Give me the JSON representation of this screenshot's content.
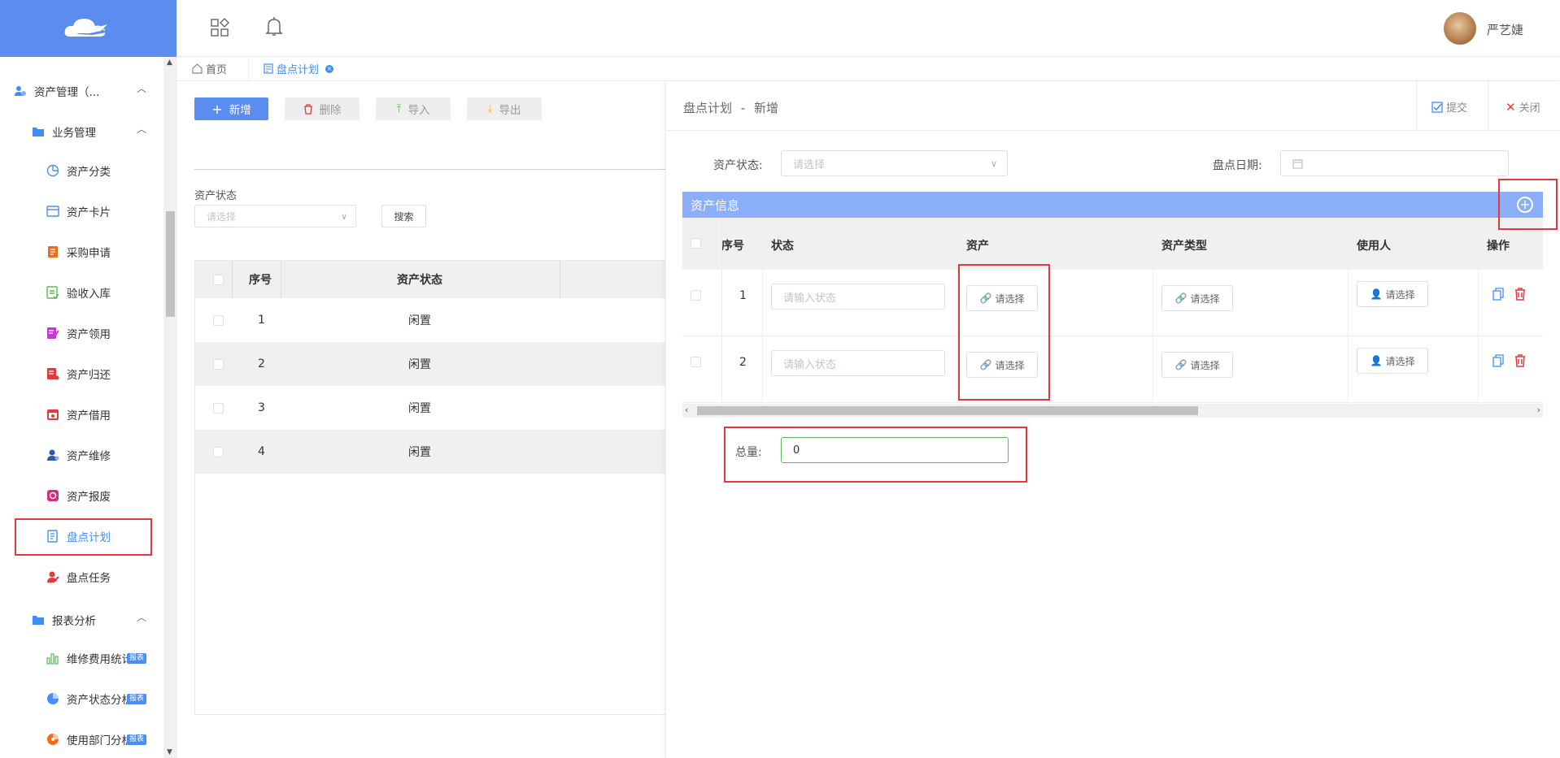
{
  "brand": {
    "accent": "#5b8cf0",
    "danger": "#e4393c",
    "link": "#3e8ef7"
  },
  "user": {
    "name": "严艺婕"
  },
  "sidebar": {
    "group": "资产管理（...",
    "business": "业务管理",
    "items": [
      {
        "label": "资产分类",
        "icon": "pie-chart-icon"
      },
      {
        "label": "资产卡片",
        "icon": "card-icon"
      },
      {
        "label": "采购申请",
        "icon": "purchase-icon"
      },
      {
        "label": "验收入库",
        "icon": "checklist-icon"
      },
      {
        "label": "资产领用",
        "icon": "edit-doc-icon"
      },
      {
        "label": "资产归还",
        "icon": "return-doc-icon"
      },
      {
        "label": "资产借用",
        "icon": "calendar-icon"
      },
      {
        "label": "资产维修",
        "icon": "repair-user-icon"
      },
      {
        "label": "资产报废",
        "icon": "scrap-icon"
      },
      {
        "label": "盘点计划",
        "icon": "plan-doc-icon"
      },
      {
        "label": "盘点任务",
        "icon": "task-user-icon"
      }
    ],
    "reports": "报表分析",
    "report_items": [
      {
        "label": "维修费用统计",
        "badge": "报表"
      },
      {
        "label": "资产状态分析",
        "badge": "报表"
      },
      {
        "label": "使用部门分析",
        "badge": "报表"
      }
    ]
  },
  "tabs": {
    "home": "首页",
    "current": "盘点计划"
  },
  "list": {
    "add": "新增",
    "delete": "删除",
    "import": "导入",
    "export": "导出",
    "filter_label": "资产状态",
    "filter_placeholder": "请选择",
    "search": "搜索",
    "col_seq": "序号",
    "col_status": "资产状态",
    "rows": [
      {
        "seq": "1",
        "status": "闲置"
      },
      {
        "seq": "2",
        "status": "闲置"
      },
      {
        "seq": "3",
        "status": "闲置"
      },
      {
        "seq": "4",
        "status": "闲置"
      }
    ]
  },
  "drawer": {
    "title": "盘点计划",
    "sep": "-",
    "mode": "新增",
    "submit": "提交",
    "close": "关闭",
    "status_label": "资产状态:",
    "status_placeholder": "请选择",
    "date_label": "盘点日期:",
    "section": "资产信息",
    "cols": {
      "seq": "序号",
      "state": "状态",
      "asset": "资产",
      "type": "资产类型",
      "user": "使用人",
      "op": "操作"
    },
    "rows": [
      {
        "seq": "1",
        "state_placeholder": "请输入状态",
        "asset": "请选择",
        "type": "请选择",
        "user": "请选择"
      },
      {
        "seq": "2",
        "state_placeholder": "请输入状态",
        "asset": "请选择",
        "type": "请选择",
        "user": "请选择"
      }
    ],
    "total_label": "总量:",
    "total_value": "0"
  }
}
